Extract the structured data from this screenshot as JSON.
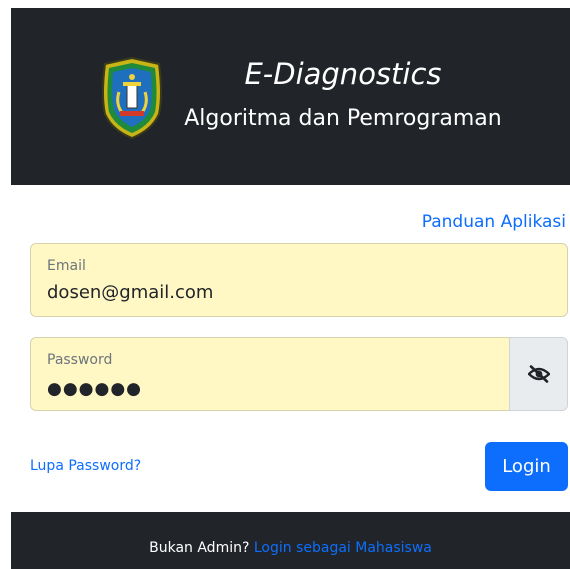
{
  "header": {
    "title": "E-Diagnostics",
    "subtitle": "Algoritma dan Pemrograman",
    "logo_icon": "regional-emblem-icon"
  },
  "guide_link": "Panduan Aplikasi",
  "email_field": {
    "label": "Email",
    "value": "dosen@gmail.com"
  },
  "password_field": {
    "label": "Password",
    "masked_value": "●●●●●●",
    "toggle_icon": "eye-slash-icon"
  },
  "forgot_password": "Lupa Password?",
  "login_button": "Login",
  "footer": {
    "text": "Bukan Admin? ",
    "link": "Login sebagai Mahasiswa"
  },
  "colors": {
    "header_bg": "#212529",
    "field_bg": "#fff7c4",
    "accent": "#0d6efd",
    "eye_button_bg": "#e9ecef"
  }
}
